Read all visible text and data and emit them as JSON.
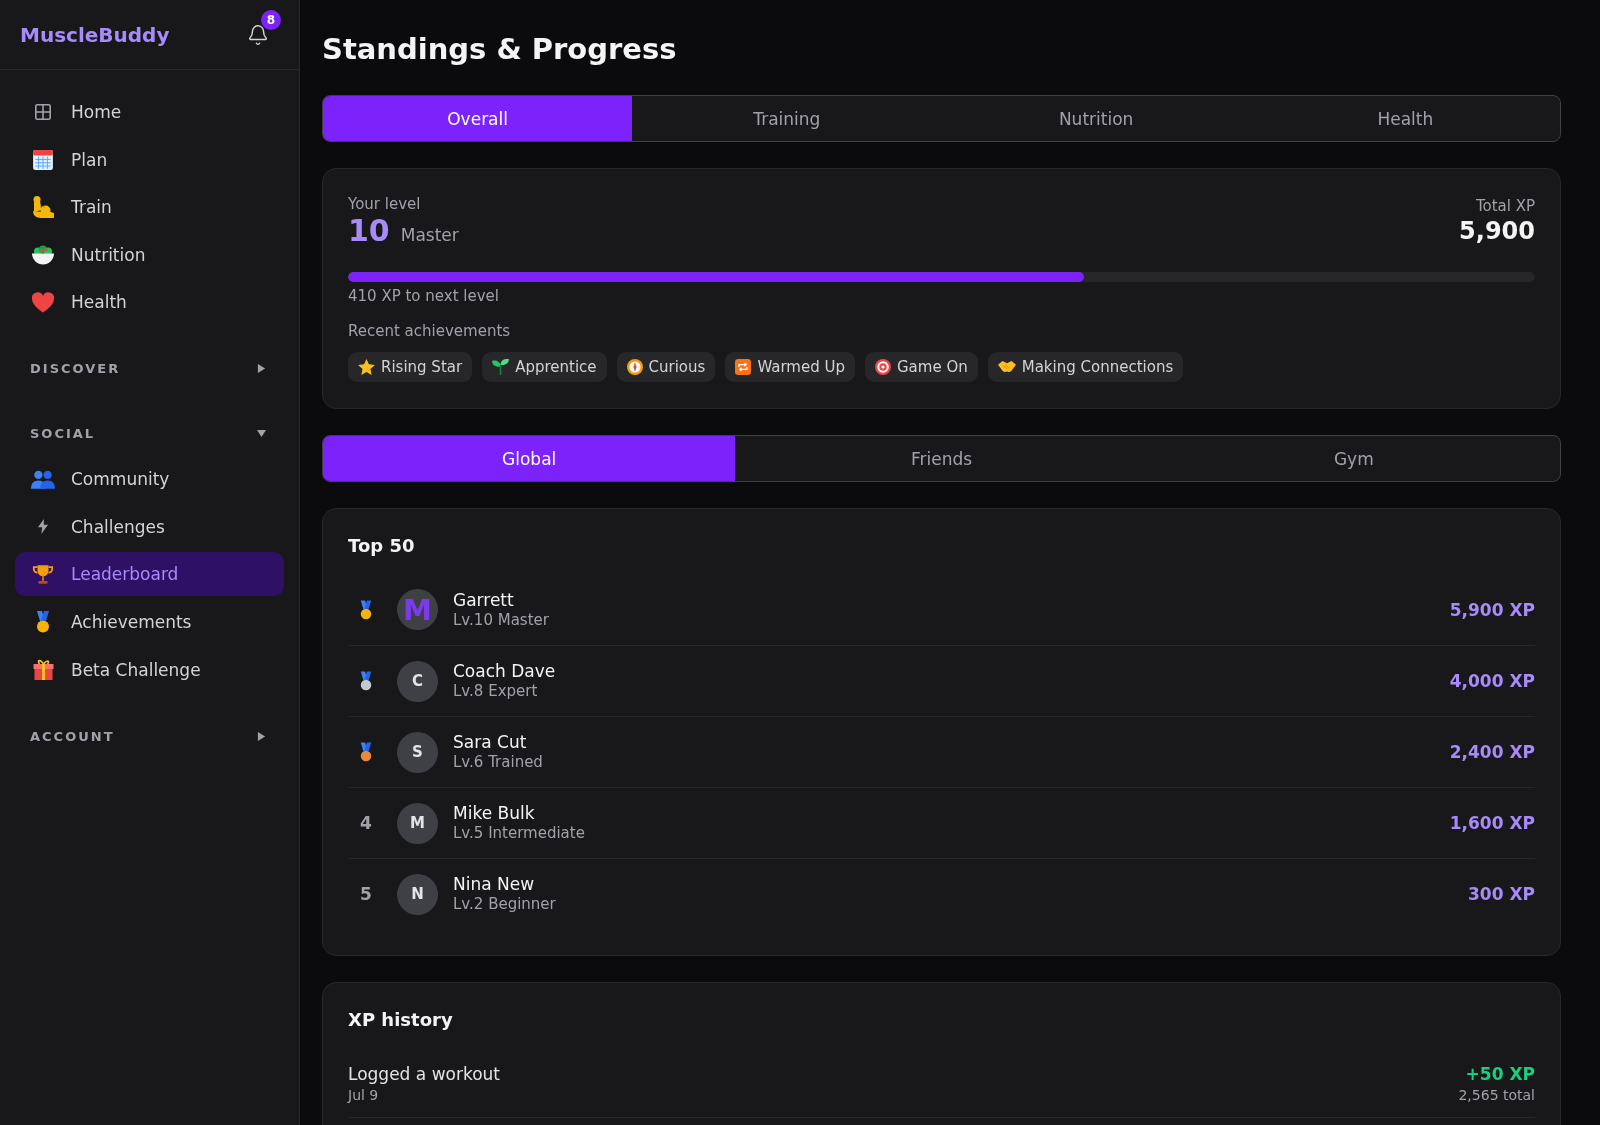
{
  "sidebar": {
    "logo": "MuscleBuddy",
    "notification_badge": "8",
    "items": [
      {
        "label": "Home",
        "selected": false
      },
      {
        "label": "Plan",
        "selected": false
      },
      {
        "label": "Train",
        "selected": false
      },
      {
        "label": "Nutrition",
        "selected": false
      },
      {
        "label": "Health",
        "selected": false
      }
    ],
    "sections": [
      {
        "title": "DISCOVER",
        "expanded": false
      },
      {
        "title": "SOCIAL",
        "expanded": true,
        "items": [
          {
            "label": "Community",
            "selected": false
          },
          {
            "label": "Challenges",
            "selected": false
          },
          {
            "label": "Leaderboard",
            "selected": true
          },
          {
            "label": "Achievements",
            "selected": false
          },
          {
            "label": "Beta Challenge",
            "selected": false
          }
        ]
      },
      {
        "title": "ACCOUNT",
        "expanded": false
      }
    ]
  },
  "page_title": "Standings & Progress",
  "category_tabs": [
    {
      "label": "Overall",
      "selected": true
    },
    {
      "label": "Training",
      "selected": false
    },
    {
      "label": "Nutrition",
      "selected": false
    },
    {
      "label": "Health",
      "selected": false
    }
  ],
  "level_card": {
    "label": "Your level",
    "level_number": "10",
    "level_title": "Master",
    "total_label": "Total XP",
    "total_value": "5,900",
    "progress": {
      "level": 0.62
    },
    "progress_caption": "410 XP to next level",
    "achievements_label": "Recent achievements",
    "achievements": [
      "Rising Star",
      "Apprentice",
      "Curious",
      "Warmed Up",
      "Game On",
      "Making Connections"
    ]
  },
  "scope_tabs": [
    {
      "label": "Global",
      "selected": true
    },
    {
      "label": "Friends",
      "selected": false
    },
    {
      "label": "Gym",
      "selected": false
    }
  ],
  "leaderboard": {
    "title": "Top 50",
    "rows": [
      {
        "kind": "medal",
        "color": "#f5b20c",
        "initial": "M",
        "current_user": true,
        "name": "Garrett",
        "subtitle": "Lv.10 Master",
        "xp": "5,900 XP"
      },
      {
        "kind": "medal",
        "color": "#c4c8d0",
        "initial": "C",
        "current_user": false,
        "name": "Coach Dave",
        "subtitle": "Lv.8 Expert",
        "xp": "4,000 XP"
      },
      {
        "kind": "medal",
        "color": "#e88a3c",
        "initial": "S",
        "current_user": false,
        "name": "Sara Cut",
        "subtitle": "Lv.6 Trained",
        "xp": "2,400 XP"
      },
      {
        "kind": "rank",
        "rank": "4",
        "initial": "M",
        "current_user": false,
        "name": "Mike Bulk",
        "subtitle": "Lv.5 Intermediate",
        "xp": "1,600 XP"
      },
      {
        "kind": "rank",
        "rank": "5",
        "initial": "N",
        "current_user": false,
        "name": "Nina New",
        "subtitle": "Lv.2 Beginner",
        "xp": "300 XP"
      }
    ]
  },
  "xp_history": {
    "title": "XP history",
    "entries": [
      {
        "label": "Logged a workout",
        "date": "Jul 9",
        "xp": "+50 XP",
        "total": "2,565 total"
      }
    ]
  }
}
